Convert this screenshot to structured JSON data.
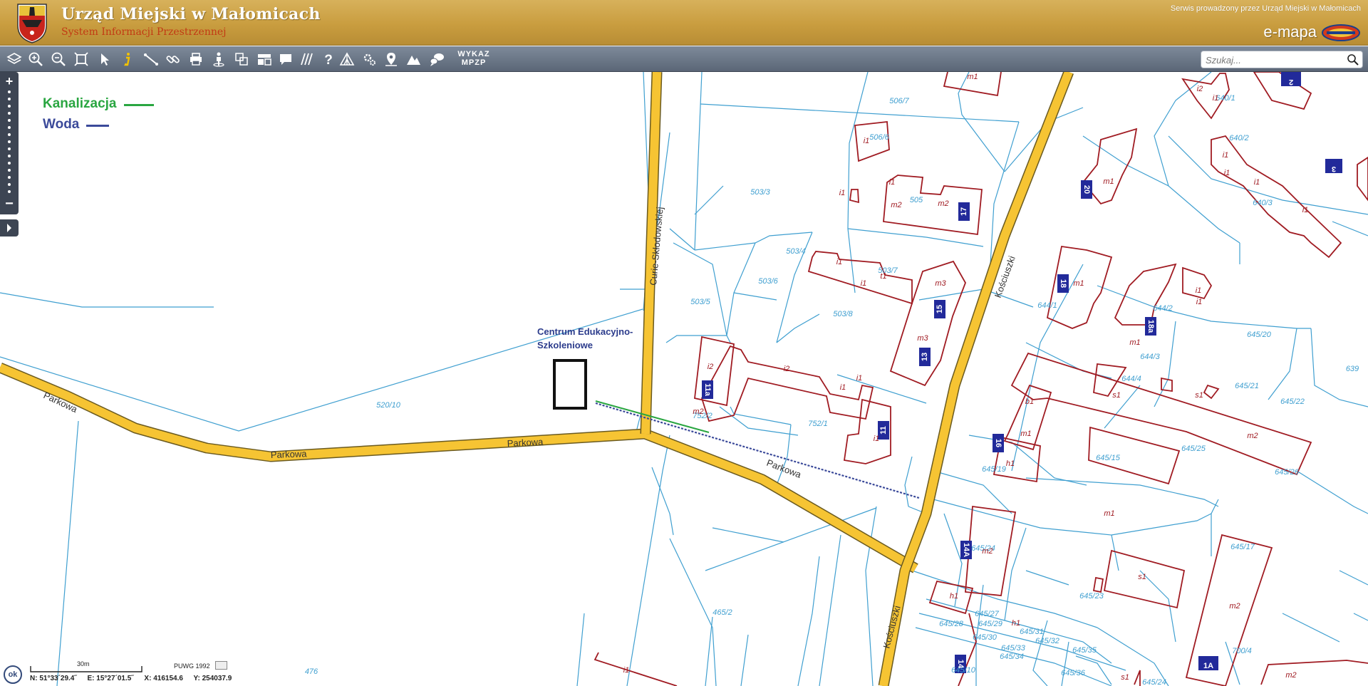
{
  "header": {
    "title": "Urząd Miejski w Małomicach",
    "subtitle": "System Informacji Przestrzennej",
    "service_text": "Serwis prowadzony przez Urząd Miejski w Małomicach",
    "brand": "e-mapa"
  },
  "toolbar": {
    "tools": [
      {
        "icon": "layers-icon"
      },
      {
        "icon": "zoom-in-icon"
      },
      {
        "icon": "zoom-out-icon"
      },
      {
        "icon": "full-extent-icon"
      },
      {
        "icon": "select-arrow-icon"
      },
      {
        "icon": "info-icon"
      },
      {
        "icon": "measure-distance-icon"
      },
      {
        "icon": "link-icon"
      },
      {
        "icon": "print-icon"
      },
      {
        "icon": "street-view-icon"
      },
      {
        "icon": "compare-icon"
      },
      {
        "icon": "layout-icon"
      },
      {
        "icon": "chat-icon"
      },
      {
        "icon": "hatch-icon"
      },
      {
        "icon": "help-icon"
      },
      {
        "icon": "tent-icon"
      },
      {
        "icon": "settings-icon"
      },
      {
        "icon": "location-pin-icon"
      },
      {
        "icon": "terrain-icon"
      },
      {
        "icon": "messages-icon"
      }
    ],
    "mpzp_label_line1": "WYKAZ",
    "mpzp_label_line2": "MPZP"
  },
  "search": {
    "placeholder": "Szukaj..."
  },
  "legend": {
    "items": [
      {
        "label": "Kanalizacja",
        "color": "#2aa641"
      },
      {
        "label": "Woda",
        "color": "#3b4a9a"
      }
    ]
  },
  "map": {
    "streets": {
      "parkowa": "Parkowa",
      "curie": "Curie-Skłodowskiej",
      "kosciuszki": "Kościuszki"
    },
    "poi": {
      "line1": "Centrum Edukacyjno-",
      "line2": "Szkoleniowe"
    },
    "parcel_labels": [
      "506/7",
      "506/6",
      "503/3",
      "505",
      "503/4",
      "503/7",
      "503/6",
      "503/5",
      "503/8",
      "520/10",
      "752/2",
      "752/1",
      "465/2",
      "476",
      "640/1",
      "640/2",
      "640/3",
      "644/1",
      "644/2",
      "644/3",
      "644/4",
      "645/20",
      "645/21",
      "645/22",
      "645/25",
      "645/26",
      "645/15",
      "645/19",
      "645/24",
      "645/23",
      "645/27",
      "645/29",
      "645/28",
      "645/30",
      "645/31",
      "645/32",
      "645/33",
      "645/34",
      "645/35",
      "645/10",
      "645/36",
      "645/17",
      "645/24",
      "700/4",
      "639"
    ],
    "building_labels": [
      "m1",
      "i1",
      "i1",
      "i1",
      "m2",
      "m2",
      "i1",
      "t1",
      "i1",
      "m3",
      "m3",
      "i2",
      "i2",
      "i1",
      "i1",
      "m2",
      "i1",
      "i2",
      "i1",
      "i1",
      "m1",
      "i1",
      "i1",
      "i1",
      "m1",
      "i1",
      "i1",
      "m1",
      "s1",
      "s1",
      "b1",
      "m1",
      "h1",
      "m2",
      "m1",
      "m2",
      "h1",
      "s1",
      "h1",
      "m2",
      "i1",
      "s1",
      "m2"
    ],
    "house_numbers": [
      "17",
      "15",
      "13",
      "11a",
      "11",
      "20",
      "18",
      "18a",
      "16",
      "14A",
      "14",
      "1A",
      "2",
      "3"
    ]
  },
  "zoom": {
    "in_label": "+",
    "out_label": "−"
  },
  "status": {
    "ok_label": "ok",
    "scale_label": "30m",
    "crs": "PUWG 1992",
    "coords": {
      "n": "N: 51°33´29.4˝",
      "e": "E: 15°27´01.5˝",
      "x": "X: 416154.6",
      "y": "Y: 254037.9"
    }
  }
}
